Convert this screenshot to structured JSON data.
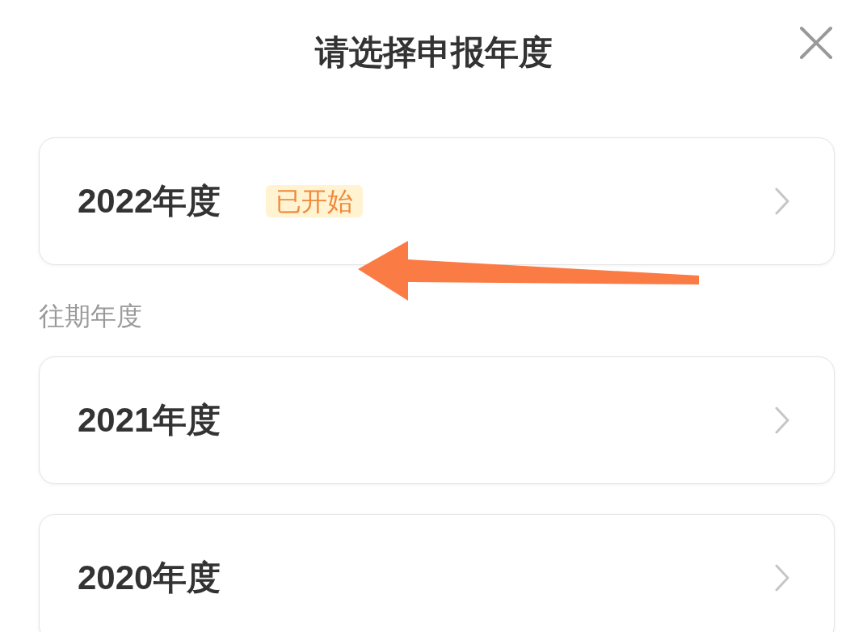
{
  "dialog": {
    "title": "请选择申报年度"
  },
  "current_years": [
    {
      "label": "2022年度",
      "badge": "已开始"
    }
  ],
  "past_section": {
    "heading": "往期年度",
    "years": [
      {
        "label": "2021年度"
      },
      {
        "label": "2020年度"
      }
    ]
  }
}
